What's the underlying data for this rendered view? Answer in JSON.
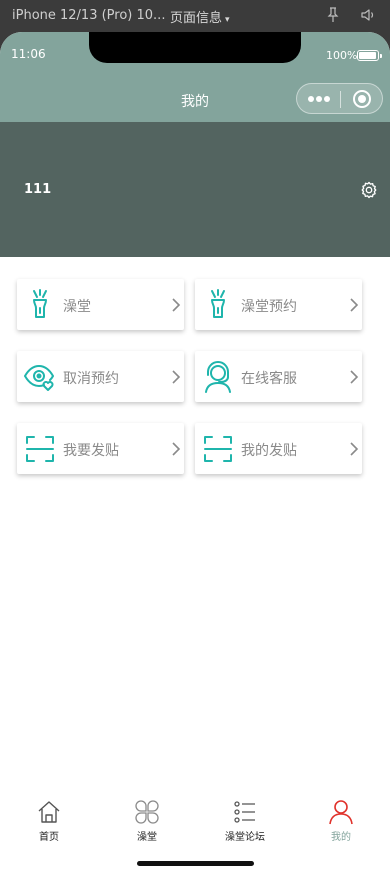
{
  "devtools": {
    "device_label": "iPhone 12/13 (Pro) 10...",
    "page_info_label": "页面信息",
    "page_info_caret": "▾",
    "pin_icon": "pin-icon",
    "speaker_icon": "speaker-icon"
  },
  "status_bar": {
    "time": "11:06",
    "battery_percent": "100%"
  },
  "nav": {
    "title": "我的"
  },
  "profile": {
    "username": "111"
  },
  "menu": [
    {
      "label": "澡堂",
      "icon": "faucet-icon"
    },
    {
      "label": "澡堂预约",
      "icon": "faucet-icon"
    },
    {
      "label": "取消预约",
      "icon": "eye-heart-icon"
    },
    {
      "label": "在线客服",
      "icon": "headset-icon"
    },
    {
      "label": "我要发贴",
      "icon": "scan-frame-icon"
    },
    {
      "label": "我的发贴",
      "icon": "scan-frame-icon"
    }
  ],
  "tabbar": [
    {
      "label": "首页",
      "icon": "home-icon",
      "active": false
    },
    {
      "label": "澡堂",
      "icon": "grid-petal-icon",
      "active": false
    },
    {
      "label": "澡堂论坛",
      "icon": "list-icon",
      "active": false
    },
    {
      "label": "我的",
      "icon": "user-icon",
      "active": true
    }
  ],
  "colors": {
    "accent": "#1fb5ac",
    "nav_bg": "#83a49c",
    "banner_bg": "#536460",
    "active_tab_icon": "#e0322b",
    "active_tab_text": "#83a49c"
  }
}
